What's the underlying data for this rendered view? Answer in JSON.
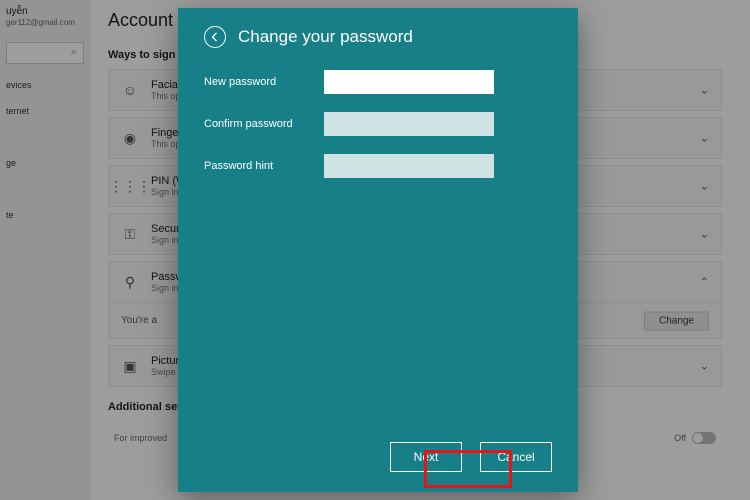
{
  "sidebar": {
    "user_name": "uyễn",
    "user_email": "ger112@gmail.com",
    "search_icon": "⌕",
    "items": [
      "evices",
      "ternet",
      "",
      "ge",
      "",
      "te"
    ]
  },
  "page": {
    "title": "Account",
    "section1": "Ways to sign in",
    "options": [
      {
        "icon": "☺",
        "title": "Facial re",
        "sub": "This opt",
        "chev": "⌄"
      },
      {
        "icon": "◉",
        "title": "Fingerp",
        "sub": "This opt",
        "chev": "⌄"
      },
      {
        "icon": "⋮⋮⋮",
        "title": "PIN (W",
        "sub": "Sign in",
        "chev": "⌄"
      },
      {
        "icon": "⚿",
        "title": "Security",
        "sub": "Sign in v",
        "chev": "⌄"
      },
      {
        "icon": "⚲",
        "title": "Passwo",
        "sub": "Sign in v",
        "chev": "⌃"
      },
      {
        "icon": "▣",
        "title": "Picture",
        "sub": "Swipe an",
        "chev": "⌄"
      }
    ],
    "expanded_text": "You're a",
    "change_label": "Change",
    "section2": "Additional setti",
    "additional_text": "For improved",
    "toggle_label": "Off"
  },
  "modal": {
    "title": "Change your password",
    "labels": {
      "new_password": "New password",
      "confirm_password": "Confirm password",
      "password_hint": "Password hint"
    },
    "buttons": {
      "next": "Next",
      "cancel": "Cancel"
    }
  }
}
